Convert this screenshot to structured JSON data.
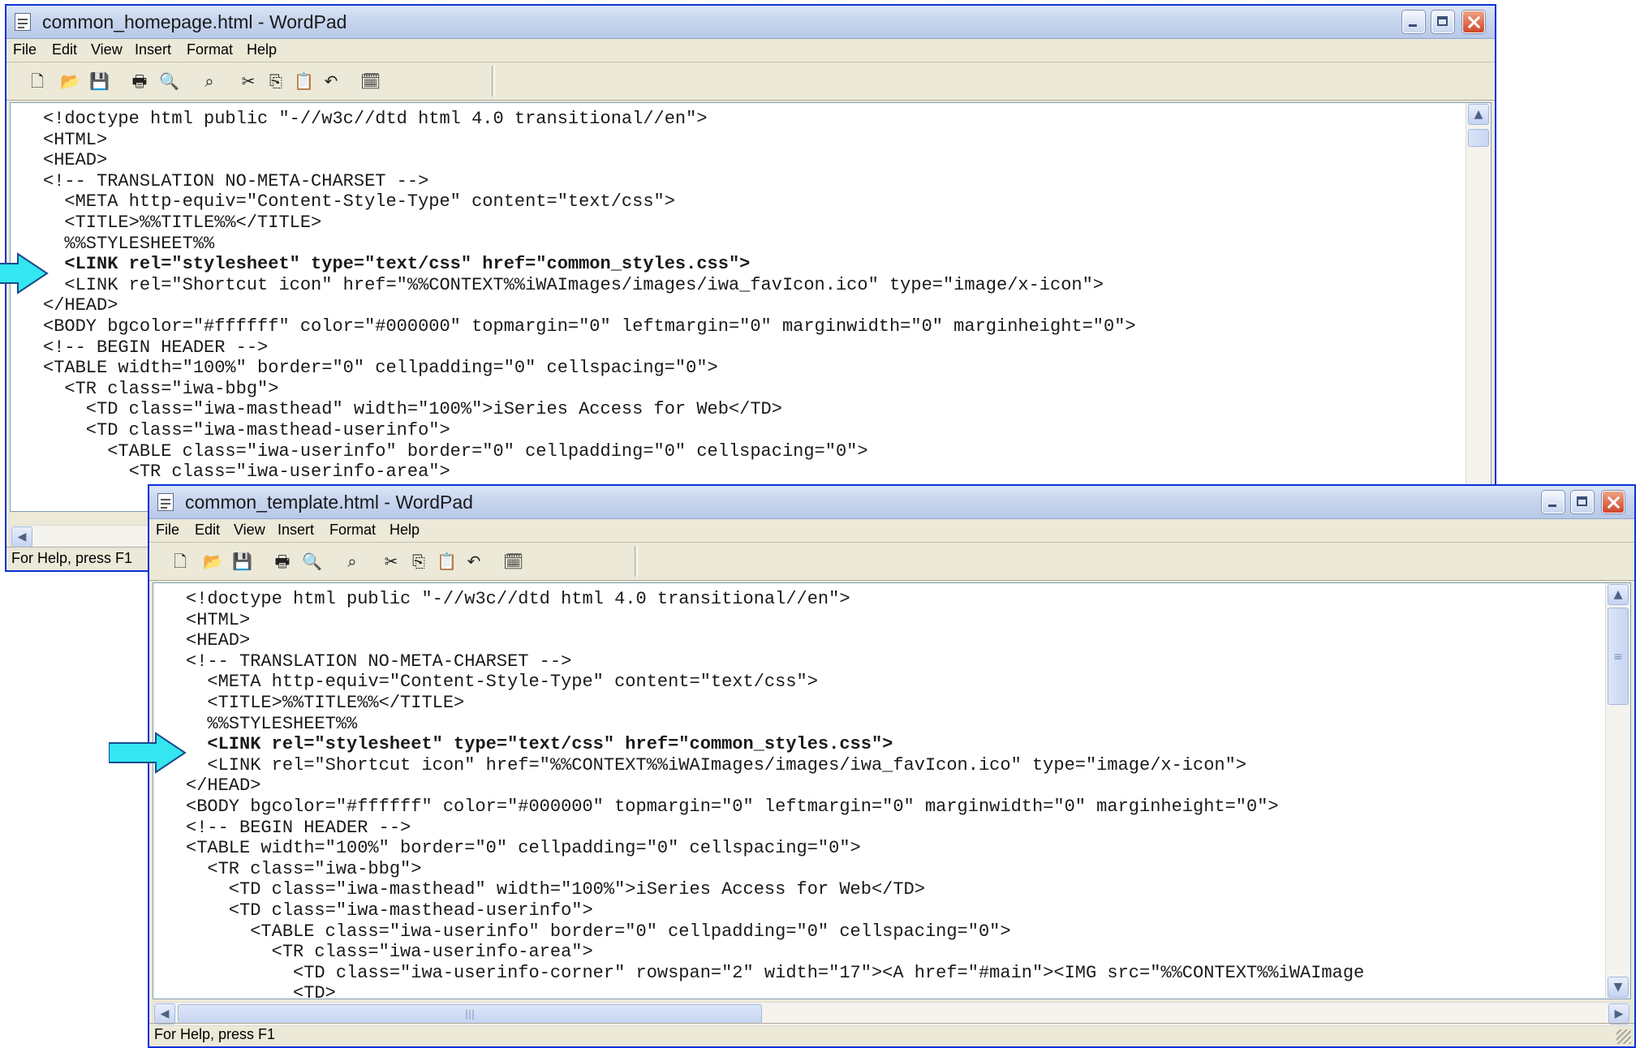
{
  "window1": {
    "title": "common_homepage.html - WordPad",
    "menu": [
      "File",
      "Edit",
      "View",
      "Insert",
      "Format",
      "Help"
    ],
    "status": "For Help, press F1",
    "lines": [
      "<!doctype html public \"-//w3c//dtd html 4.0 transitional//en\">",
      "<HTML>",
      "<HEAD>",
      "<!-- TRANSLATION NO-META-CHARSET -->",
      "  <META http-equiv=\"Content-Style-Type\" content=\"text/css\">",
      "  <TITLE>%%TITLE%%</TITLE>",
      "  %%STYLESHEET%%",
      "  <LINK rel=\"stylesheet\" type=\"text/css\" href=\"common_styles.css\">",
      "  <LINK rel=\"Shortcut icon\" href=\"%%CONTEXT%%iWAImages/images/iwa_favIcon.ico\" type=\"image/x-icon\">",
      "</HEAD>",
      "<BODY bgcolor=\"#ffffff\" color=\"#000000\" topmargin=\"0\" leftmargin=\"0\" marginwidth=\"0\" marginheight=\"0\">",
      "<!-- BEGIN HEADER -->",
      "<TABLE width=\"100%\" border=\"0\" cellpadding=\"0\" cellspacing=\"0\">",
      "  <TR class=\"iwa-bbg\">",
      "    <TD class=\"iwa-masthead\" width=\"100%\">iSeries Access for Web</TD>",
      "    <TD class=\"iwa-masthead-userinfo\">",
      "      <TABLE class=\"iwa-userinfo\" border=\"0\" cellpadding=\"0\" cellspacing=\"0\">",
      "        <TR class=\"iwa-userinfo-area\">"
    ]
  },
  "window2": {
    "title": "common_template.html - WordPad",
    "menu": [
      "File",
      "Edit",
      "View",
      "Insert",
      "Format",
      "Help"
    ],
    "status": "For Help, press F1",
    "lines": [
      "<!doctype html public \"-//w3c//dtd html 4.0 transitional//en\">",
      "<HTML>",
      "<HEAD>",
      "<!-- TRANSLATION NO-META-CHARSET -->",
      "  <META http-equiv=\"Content-Style-Type\" content=\"text/css\">",
      "  <TITLE>%%TITLE%%</TITLE>",
      "  %%STYLESHEET%%",
      "  <LINK rel=\"stylesheet\" type=\"text/css\" href=\"common_styles.css\">",
      "  <LINK rel=\"Shortcut icon\" href=\"%%CONTEXT%%iWAImages/images/iwa_favIcon.ico\" type=\"image/x-icon\">",
      "</HEAD>",
      "<BODY bgcolor=\"#ffffff\" color=\"#000000\" topmargin=\"0\" leftmargin=\"0\" marginwidth=\"0\" marginheight=\"0\">",
      "<!-- BEGIN HEADER -->",
      "<TABLE width=\"100%\" border=\"0\" cellpadding=\"0\" cellspacing=\"0\">",
      "  <TR class=\"iwa-bbg\">",
      "    <TD class=\"iwa-masthead\" width=\"100%\">iSeries Access for Web</TD>",
      "    <TD class=\"iwa-masthead-userinfo\">",
      "      <TABLE class=\"iwa-userinfo\" border=\"0\" cellpadding=\"0\" cellspacing=\"0\">",
      "        <TR class=\"iwa-userinfo-area\">",
      "          <TD class=\"iwa-userinfo-corner\" rowspan=\"2\" width=\"17\"><A href=\"#main\"><IMG src=\"%%CONTEXT%%iWAImage",
      "          <TD>"
    ]
  },
  "highlight_line_index": 7,
  "colors": {
    "arrow_fill": "#33e6f0",
    "arrow_stroke": "#1a4a8a",
    "title_bar": "#c9d7ef",
    "window_frame": "#0831d9"
  },
  "icons": [
    "new-icon",
    "open-icon",
    "save-icon",
    "print-icon",
    "print-preview-icon",
    "find-icon",
    "cut-icon",
    "copy-icon",
    "paste-icon",
    "undo-icon",
    "datetime-icon"
  ]
}
